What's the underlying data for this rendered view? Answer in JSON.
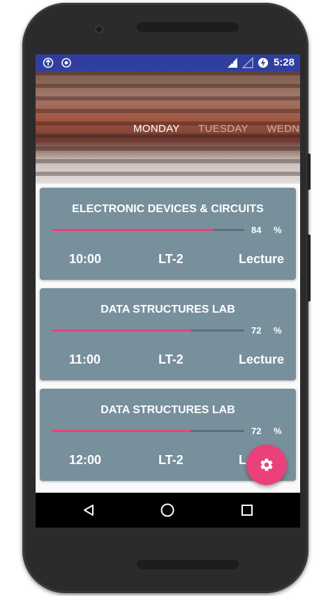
{
  "status_bar": {
    "time": "5:28"
  },
  "header": {
    "tabs": [
      {
        "label": "MONDAY",
        "active": true
      },
      {
        "label": "TUESDAY",
        "active": false
      },
      {
        "label": "WEDN",
        "active": false
      }
    ]
  },
  "cards": [
    {
      "subject": "ELECTRONIC DEVICES & CIRCUITS",
      "percent": "84",
      "percent_sign": "%",
      "progress": 0.84,
      "time": "10:00",
      "room": "LT-2",
      "type": "Lecture"
    },
    {
      "subject": "DATA STRUCTURES  LAB",
      "percent": "72",
      "percent_sign": "%",
      "progress": 0.72,
      "time": "11:00",
      "room": "LT-2",
      "type": "Lecture"
    },
    {
      "subject": "DATA STRUCTURES  LAB",
      "percent": "72",
      "percent_sign": "%",
      "progress": 0.72,
      "time": "12:00",
      "room": "LT-2",
      "type": "Lecture"
    }
  ],
  "fab": {
    "icon": "gear-icon"
  },
  "nav": {
    "back_icon": "back-icon",
    "home_icon": "home-icon",
    "recents_icon": "recents-icon"
  },
  "colors": {
    "status_bar": "#303f9f",
    "card": "#78909c",
    "accent": "#ec407a",
    "track": "#5d6f78"
  }
}
